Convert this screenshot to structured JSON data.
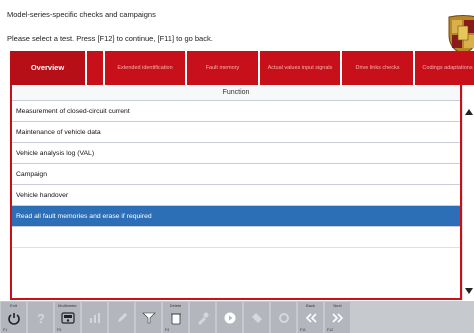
{
  "header": {
    "title": "Model-series-specific checks and campaigns",
    "instruction": "Please select a test. Press [F12] to continue, [F11] to go back."
  },
  "tabs": [
    {
      "label": "Overview",
      "active": true
    },
    {
      "label": "",
      "active": false
    },
    {
      "label": "Extended identification",
      "active": false
    },
    {
      "label": "Fault memory",
      "active": false
    },
    {
      "label": "Actual values input signals",
      "active": false
    },
    {
      "label": "Drive links checks",
      "active": false
    },
    {
      "label": "Codings adaptations",
      "active": false
    }
  ],
  "table": {
    "column_header": "Function",
    "rows": [
      "Measurement of closed-circuit current",
      "Maintenance of vehicle data",
      "Vehicle analysis log (VAL)",
      "Campaign",
      "Vehicle handover",
      "Read all fault memories and erase if required"
    ],
    "selected_index": 5
  },
  "toolbar": {
    "exit_label": "Exit",
    "multimeter_label": "Multimeter",
    "delete_label": "Delete",
    "back_label": "Back",
    "next_label": "Next",
    "key_labels": [
      "F1",
      "F3",
      "F4",
      "F7",
      "F11",
      "F12"
    ]
  },
  "colors": {
    "accent_red": "#c8101a",
    "selection_blue": "#2d6fb6",
    "toolbar_gray": "#c6c9ce"
  }
}
